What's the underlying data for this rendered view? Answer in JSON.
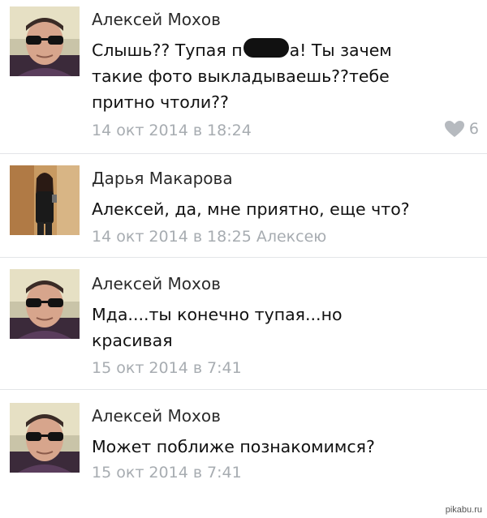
{
  "comments": [
    {
      "author": "Алексей Мохов",
      "text_lines": [
        "Слышь?? Тупая п",
        "а! Ты зачем",
        "такие фото выкладываешь??тебе",
        "притно чтоли??"
      ],
      "meta": "14 окт 2014 в 18:24",
      "likes": "6",
      "avatar": "avatar-man-sunglasses"
    },
    {
      "author": "Дарья Макарова",
      "text_lines": [
        "Алексей, да, мне приятно, еще что?"
      ],
      "meta": "14 окт 2014 в 18:25 Алексею",
      "avatar": "avatar-woman"
    },
    {
      "author": "Алексей Мохов",
      "text_lines": [
        "Мда....ты конечно тупая...но",
        "красивая"
      ],
      "meta": "15 окт 2014 в 7:41",
      "avatar": "avatar-man-sunglasses"
    },
    {
      "author": "Алексей Мохов",
      "text_lines": [
        "Может поближе познакомимся?"
      ],
      "meta": "15 окт 2014 в 7:41",
      "avatar": "avatar-man-sunglasses"
    }
  ],
  "icons": {
    "like": "heart-icon"
  },
  "watermark": "pikabu.ru",
  "colors": {
    "meta": "#a7acb1",
    "divider": "#e3e5e8",
    "author": "#2b2b2b",
    "text": "#111111"
  }
}
